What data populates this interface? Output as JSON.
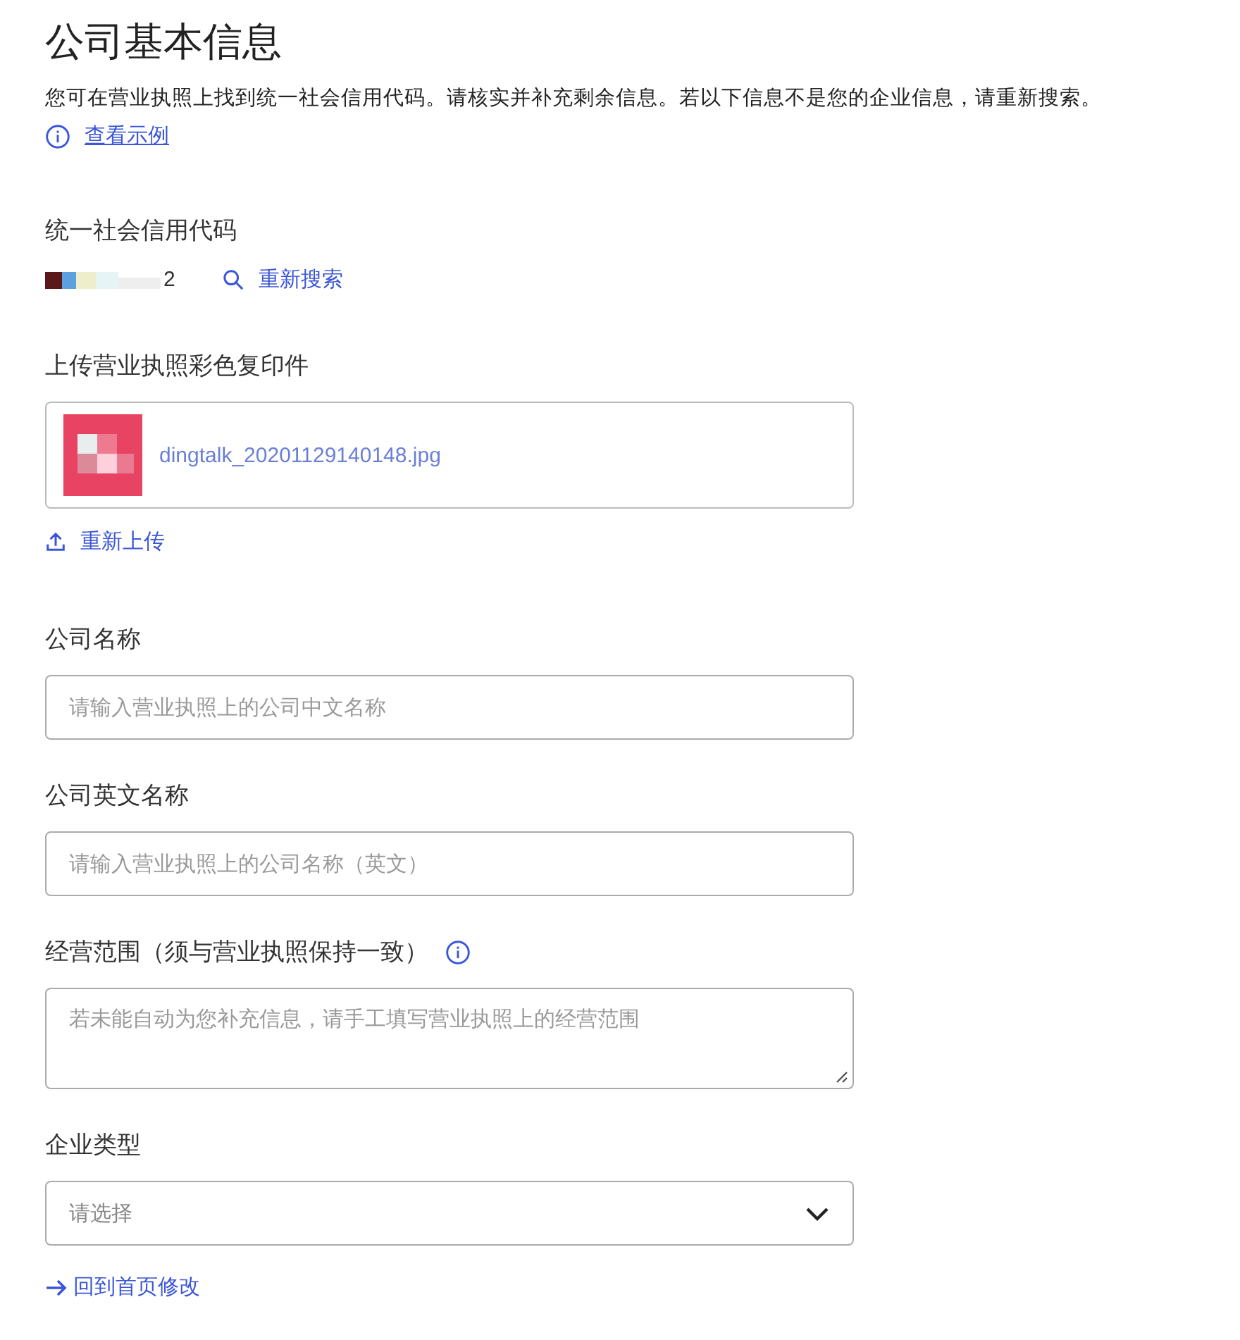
{
  "title": "公司基本信息",
  "description": "您可在营业执照上找到统一社会信用代码。请核实并补充剩余信息。若以下信息不是您的企业信息，请重新搜索。",
  "example_link": "查看示例",
  "credit_code": {
    "label": "统一社会信用代码",
    "value_tail": "2",
    "research_link": "重新搜索"
  },
  "upload": {
    "label": "上传营业执照彩色复印件",
    "file": {
      "kind": "picture",
      "name": "dingtalk_20201129140148.jpg"
    },
    "reupload_link": "重新上传"
  },
  "fields": [
    {
      "kind": "input",
      "label": "公司名称",
      "placeholder": "请输入营业执照上的公司中文名称"
    },
    {
      "kind": "input",
      "label": "公司英文名称",
      "placeholder": "请输入营业执照上的公司名称（英文）"
    },
    {
      "kind": "textarea",
      "label": "经营范围（须与营业执照保持一致）",
      "info": true,
      "placeholder": "若未能自动为您补充信息，请手工填写营业执照上的经营范围"
    },
    {
      "kind": "select",
      "label": "企业类型",
      "placeholder": "请选择"
    }
  ],
  "back_link": "回到首页修改"
}
